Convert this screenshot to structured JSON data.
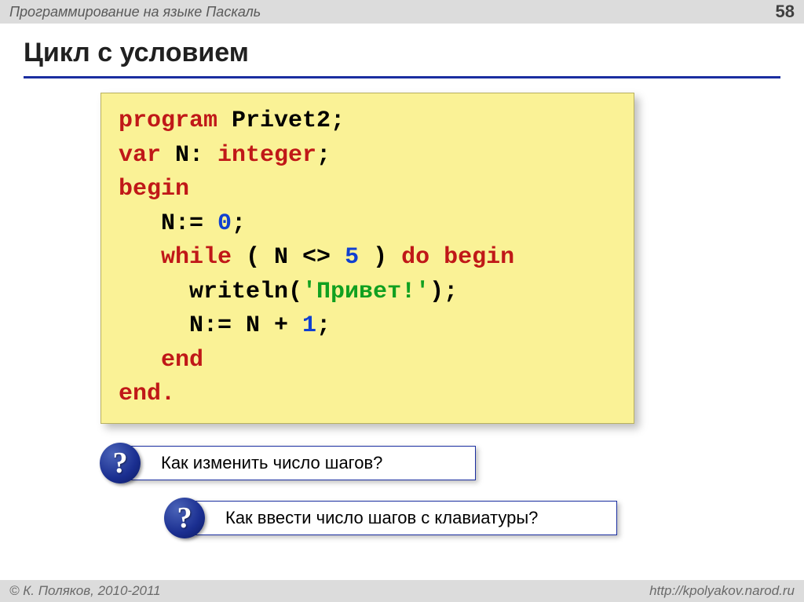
{
  "header": {
    "subject": "Программирование на языке Паскаль",
    "page": "58"
  },
  "title": "Цикл с условием",
  "code": {
    "l1a": "program",
    "l1b": " Privet2;",
    "l2a": "var",
    "l2b": " N: ",
    "l2c": "integer",
    "l2d": ";",
    "l3": "begin",
    "l4a": "   N:= ",
    "l4b": "0",
    "l4c": ";",
    "l5a": "   while",
    "l5b": " ( N <> ",
    "l5c": "5",
    "l5d": " ) ",
    "l5e": "do begin",
    "l6a": "     writeln(",
    "l6b": "'Привет!'",
    "l6c": ");",
    "l7a": "     N:= N + ",
    "l7b": "1",
    "l7c": ";",
    "l8": "   end",
    "l9": "end."
  },
  "questions": {
    "q1": "Как изменить число шагов?",
    "q2": "Как ввести число шагов с клавиатуры?",
    "icon": "?"
  },
  "footer": {
    "left": "© К. Поляков, 2010-2011",
    "right": "http://kpolyakov.narod.ru"
  }
}
